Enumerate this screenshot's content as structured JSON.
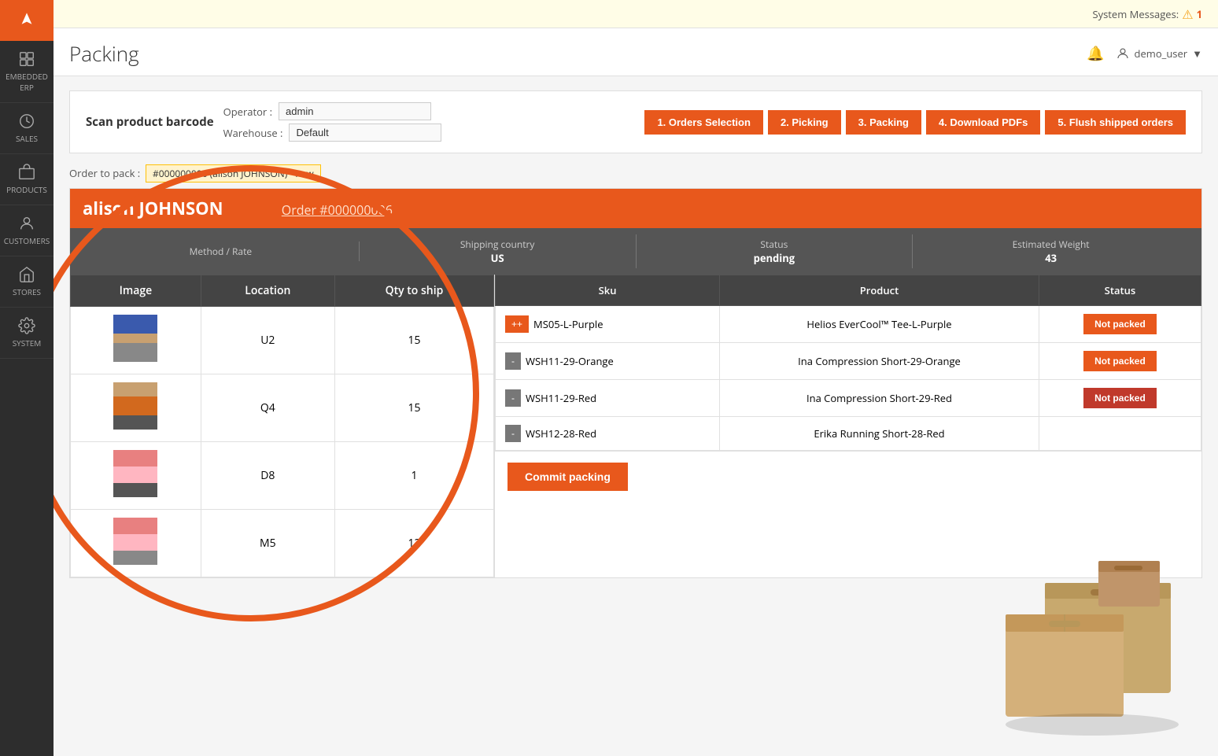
{
  "system_messages": {
    "label": "System Messages:",
    "count": "1"
  },
  "page": {
    "title": "Packing"
  },
  "header": {
    "bell_label": "🔔",
    "user_label": "demo_user",
    "user_caret": "▼"
  },
  "scan_bar": {
    "label": "Scan product barcode",
    "operator_label": "Operator :",
    "operator_value": "admin",
    "warehouse_label": "Warehouse :",
    "warehouse_value": "Default"
  },
  "steps": [
    {
      "id": "1",
      "label": "1. Orders Selection"
    },
    {
      "id": "2",
      "label": "2. Picking"
    },
    {
      "id": "3",
      "label": "3. Packing"
    },
    {
      "id": "4",
      "label": "4. Download PDFs"
    },
    {
      "id": "5",
      "label": "5. Flush shipped orders"
    }
  ],
  "order_to_pack": {
    "label": "Order to pack :",
    "value": "#000000006 (alison JOHNSON) - new"
  },
  "order": {
    "customer": "alison JOHNSON",
    "order_link": "Order #000000006",
    "meta": {
      "method_rate_label": "Method / Rate",
      "method_rate_value": "",
      "shipping_country_label": "Shipping country",
      "shipping_country_value": "US",
      "status_label": "Status",
      "status_value": "pending",
      "estimated_weight_label": "Estimated Weight",
      "estimated_weight_value": "43"
    }
  },
  "left_table": {
    "headers": [
      "Image",
      "Location",
      "Qty to ship"
    ],
    "rows": [
      {
        "location": "U2",
        "qty": "15",
        "person_class": "person-1"
      },
      {
        "location": "Q4",
        "qty": "15",
        "person_class": "person-2"
      },
      {
        "location": "D8",
        "qty": "1",
        "person_class": "person-3"
      },
      {
        "location": "M5",
        "qty": "12",
        "person_class": "person-4"
      }
    ]
  },
  "right_table": {
    "headers": [
      "Sku",
      "Product",
      "Status"
    ],
    "rows": [
      {
        "sku": "MS05-L-Purple",
        "product": "Helios EverCool™ Tee-L-Purple",
        "status": "Not packed",
        "status_type": "not_packed"
      },
      {
        "sku": "WSH11-29-Orange",
        "product": "Ina Compression Short-29-Orange",
        "status": "Not packed",
        "status_type": "not_packed"
      },
      {
        "sku": "WSH11-29-Red",
        "product": "Ina Compression Short-29-Red",
        "status": "Not packed",
        "status_type": "not_packed_partial"
      },
      {
        "sku": "WSH12-28-Red",
        "product": "Erika Running Short-28-Red",
        "status": "",
        "status_type": "none"
      }
    ]
  },
  "commit_button": {
    "label": "Commit packing"
  },
  "sidebar": {
    "items": [
      {
        "id": "embedded-erp",
        "label": "EMBEDDED ERP"
      },
      {
        "id": "sales",
        "label": "SALES"
      },
      {
        "id": "products",
        "label": "PRODUCTS"
      },
      {
        "id": "customers",
        "label": "CUSTOMERS"
      },
      {
        "id": "stores",
        "label": "STORES"
      },
      {
        "id": "system",
        "label": "SYSTEM"
      }
    ]
  }
}
